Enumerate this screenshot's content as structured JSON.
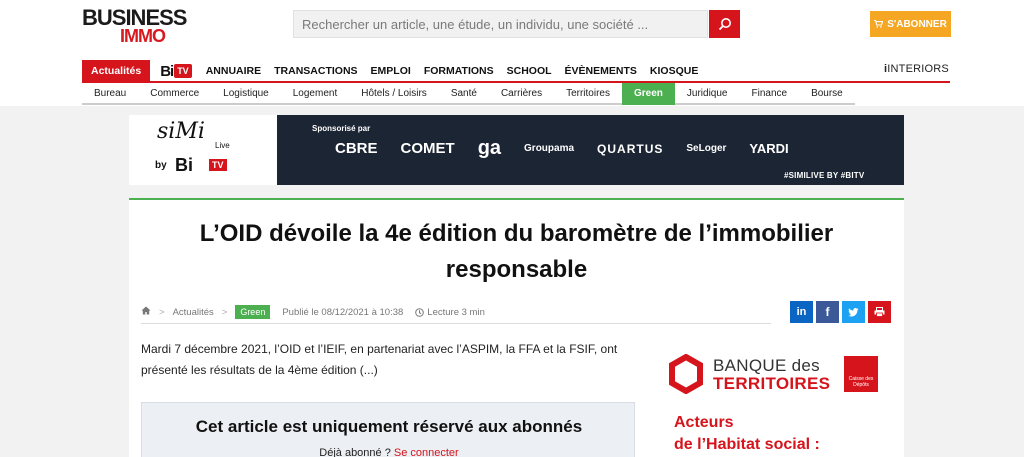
{
  "header": {
    "logo_line1": "BUSINESS",
    "logo_line2": "IMMO",
    "search_placeholder": "Rechercher un article, une étude, un individu, une société ...",
    "subscribe_label": "S'ABONNER"
  },
  "nav": {
    "items": [
      "Actualités",
      "ANNUAIRE",
      "TRANSACTIONS",
      "EMPLOI",
      "FORMATIONS",
      "SCHOOL",
      "ÉVÈNEMENTS",
      "KIOSQUE"
    ],
    "bitv_bi": "Bi",
    "bitv_tv": "TV",
    "interiors": "INTERIORS"
  },
  "subnav": {
    "items": [
      "Bureau",
      "Commerce",
      "Logistique",
      "Logement",
      "Hôtels / Loisirs",
      "Santé",
      "Carrières",
      "Territoires",
      "Green",
      "Juridique",
      "Finance",
      "Bourse"
    ],
    "active": "Green"
  },
  "banner": {
    "simi": "siMi",
    "live": "Live",
    "by": "by",
    "bi": "Bi",
    "tv": "TV",
    "sponsor_label": "Sponsorisé par",
    "brands": [
      "CBRE",
      "COMET",
      "ga",
      "Groupama",
      "QUARTUS",
      "SeLoger",
      "YARDI"
    ],
    "hashtag": "#SIMILIVE BY #BITV"
  },
  "article": {
    "title": "L’OID dévoile la 4e édition du baromètre de l’immobilier responsable",
    "breadcrumb_section": "Actualités",
    "tag": "Green",
    "published": "Publié le 08/12/2021 à 10:38",
    "read_time": "Lecture 3 min",
    "intro": "Mardi 7 décembre 2021, l’OID et l’IEIF, en partenariat avec l’ASPIM, la FFA et la FSIF, ont présenté les résultats de la 4ème édition (...)",
    "paywall_title": "Cet article est uniquement réservé aux abonnés",
    "paywall_text": "Déjà abonné ?",
    "paywall_link": "Se connecter"
  },
  "ad": {
    "line1": "BANQUE des",
    "line2": "TERRITOIRES",
    "cdc": "Caisse des Dépôts",
    "headline_line1": "Acteurs",
    "headline_line2": "de l’Habitat social :"
  },
  "colors": {
    "brand_red": "#d6141c",
    "green": "#4caf50",
    "subscribe_orange": "#f5a623",
    "linkedin": "#0a66c2",
    "facebook": "#3b5998",
    "twitter": "#1da1f2",
    "print": "#d6141c"
  }
}
